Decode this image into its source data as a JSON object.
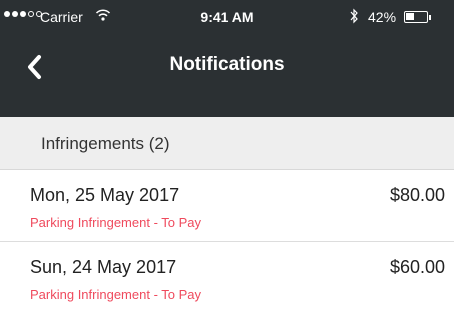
{
  "status_bar": {
    "carrier": "Carrier",
    "time": "9:41 AM",
    "battery": "42%",
    "battery_level": 0.42,
    "signal_bars_filled": 3,
    "signal_bars_total": 5,
    "icons": [
      "signal-dots-icon",
      "wifi-icon",
      "bluetooth-icon",
      "battery-icon"
    ]
  },
  "nav": {
    "title": "Notifications",
    "back_icon": "chevron-left-icon"
  },
  "section": {
    "title": "Infringements (2)"
  },
  "items": [
    {
      "date": "Mon, 25 May 2017",
      "amount": "$80.00",
      "status": "Parking Infringement - To Pay"
    },
    {
      "date": "Sun, 24 May 2017",
      "amount": "$60.00",
      "status": "Parking Infringement - To Pay"
    }
  ],
  "colors": {
    "header_bg": "#2b3033",
    "section_bg": "#eeeeee",
    "status_text": "#ef4a5d",
    "primary_text": "#222222"
  }
}
